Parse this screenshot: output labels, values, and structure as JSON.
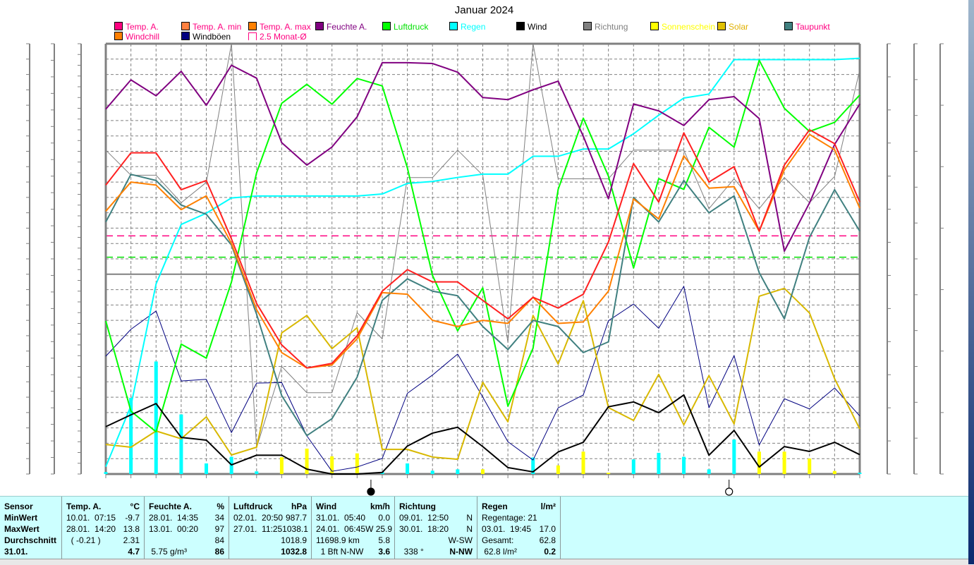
{
  "chart_data": {
    "type": "line",
    "title": "Januar 2024",
    "x": [
      1,
      2,
      3,
      4,
      5,
      6,
      7,
      8,
      9,
      10,
      11,
      12,
      13,
      14,
      15,
      16,
      17,
      18,
      19,
      20,
      21,
      22,
      23,
      24,
      25,
      26,
      27,
      28,
      29,
      30,
      31
    ],
    "xlim": [
      1,
      31
    ],
    "grid": true,
    "legend_position": "top",
    "axes": {
      "temp": {
        "unit": "°C",
        "min": -13,
        "max": 15,
        "color": "#ff0080",
        "side": "left",
        "ticks": [
          "15.0",
          "14.0",
          "13.0",
          "12.0",
          "11.0",
          "10.0",
          "9.0",
          "8.0",
          "7.0",
          "6.0",
          "5.0",
          "4.0",
          "3.0",
          "2.0",
          "1.0",
          "0.0",
          "-1.0",
          "-2.0",
          "-3.0",
          "-4.0",
          "-5.0",
          "-6.0",
          "-7.0",
          "-8.0",
          "-9.0",
          "-10.0",
          "-11.0",
          "-12.0",
          "-13.0"
        ]
      },
      "hpa": {
        "unit": "hPa",
        "min": 987,
        "max": 1039,
        "color": "#00e000",
        "side": "left",
        "ticks": [
          "1039",
          "1037",
          "1035",
          "1033",
          "1031",
          "1029",
          "1027",
          "1025",
          "1023",
          "1021",
          "1019",
          "1017",
          "1015",
          "1013",
          "1011",
          "1009",
          "1007",
          "1005",
          "1003",
          "1001",
          "999",
          "997",
          "995",
          "993",
          "991",
          "989",
          "987"
        ]
      },
      "kmh": {
        "unit": "km/h",
        "min": 0,
        "max": 80,
        "color": "#000000",
        "side": "left",
        "ticks": [
          "80.0",
          "78.0",
          "76.0",
          "74.0",
          "72.0",
          "70.0",
          "68.0",
          "66.0",
          "64.0",
          "62.0",
          "60.0",
          "58.0",
          "56.0",
          "54.0",
          "52.0",
          "50.0",
          "48.0",
          "46.0",
          "44.0",
          "42.0",
          "40.0",
          "38.0",
          "36.0",
          "34.0",
          "32.0",
          "30.0",
          "28.0",
          "26.0",
          "24.0",
          "22.0",
          "20.0",
          "18.0",
          "16.0",
          "14.0",
          "12.0",
          "10.0",
          "8.0",
          "6.0",
          "4.0",
          "2.0",
          "0.0"
        ]
      },
      "h": {
        "unit": "h",
        "min": 0,
        "max": 100,
        "color": "#e8e800",
        "side": "left",
        "ticks": [
          "100",
          "90",
          "80",
          "70",
          "60",
          "50",
          "40",
          "30",
          "20",
          "10",
          "0"
        ]
      },
      "pct": {
        "unit": "%",
        "min": 0,
        "max": 100,
        "color": "#800080",
        "side": "right",
        "ticks": [
          "100",
          "90",
          "80",
          "70",
          "60",
          "50",
          "40",
          "30",
          "20",
          "10",
          "0"
        ]
      },
      "lm2": {
        "unit": "l/m²",
        "min": 0,
        "max": 65,
        "color": "#00e8e8",
        "side": "right",
        "ticks": [
          "65.0",
          "60.0",
          "55.0",
          "50.0",
          "45.0",
          "40.0",
          "35.0",
          "30.0",
          "25.0",
          "20.0",
          "15.0",
          "10.0",
          "5.0",
          "0.0"
        ]
      },
      "deg": {
        "unit": "°",
        "min": 0,
        "max": 360,
        "color": "#808080",
        "side": "right",
        "ticks": [
          "360 N",
          "330",
          "300",
          "270 W",
          "240",
          "210",
          "180 S",
          "150",
          "120",
          "90 O",
          "60",
          "30",
          "0 N"
        ]
      },
      "wm2": {
        "unit": "W/m²",
        "min": 0,
        "max": 350,
        "color": "#d8b800",
        "side": "right",
        "ticks": [
          "350",
          "300",
          "250",
          "200",
          "150",
          "100",
          "50",
          "0"
        ]
      }
    },
    "series": [
      {
        "name": "Regen",
        "kind": "bar",
        "axis": "lm2",
        "color": "#00ffff",
        "values": [
          0.3,
          11.5,
          17.0,
          9.0,
          1.6,
          2.6,
          0.4,
          0,
          0,
          0,
          0,
          0.3,
          1.6,
          0.5,
          0.7,
          0.5,
          0,
          2.5,
          0,
          1.1,
          0,
          2.2,
          3.2,
          2.6,
          0.7,
          5.2,
          0,
          0,
          0,
          0,
          0.2
        ]
      },
      {
        "name": "Sonnenschein",
        "kind": "bar",
        "axis": "h",
        "color": "#ffff00",
        "values": [
          0,
          0,
          0,
          0,
          0,
          0,
          0,
          3.9,
          5.9,
          4.1,
          4.8,
          0,
          0,
          0,
          0,
          1.1,
          0,
          0,
          2.0,
          5.2,
          0.3,
          0,
          0,
          0,
          0,
          0,
          5.2,
          5.2,
          3.6,
          0.7,
          0
        ]
      },
      {
        "name": "Richtung",
        "kind": "line",
        "axis": "deg",
        "color": "#808080",
        "width": 1,
        "values": [
          271,
          250,
          250,
          227,
          244,
          360,
          22,
          90,
          68,
          68,
          135,
          113,
          248,
          248,
          271,
          250,
          110,
          360,
          247,
          247,
          247,
          271,
          271,
          271,
          222,
          247,
          222,
          248,
          227,
          249,
          338
        ]
      },
      {
        "name": "Windböen",
        "kind": "line",
        "axis": "kmh",
        "color": "#000080",
        "width": 1,
        "values": [
          21.9,
          26.9,
          30.3,
          17.3,
          17.6,
          7.7,
          16.9,
          17.0,
          7.1,
          0.5,
          1.3,
          2.9,
          15.0,
          18.4,
          22.3,
          14.3,
          6.0,
          2.6,
          12.3,
          14.7,
          28.5,
          31.6,
          27.1,
          34.9,
          12.3,
          22.0,
          5.4,
          14.0,
          12.1,
          16.0,
          10.8
        ]
      },
      {
        "name": "Solar",
        "kind": "line",
        "axis": "wm2",
        "color": "#d8b800",
        "width": 2,
        "values": [
          24,
          21.8,
          35,
          28.7,
          46.5,
          15.5,
          21.8,
          114.8,
          129,
          102,
          119,
          20,
          20,
          13.8,
          12,
          74.6,
          42.5,
          129,
          89.5,
          141,
          54,
          43.6,
          81,
          40,
          80,
          40.7,
          144.6,
          151,
          131,
          77.5,
          36.7
        ]
      },
      {
        "name": "Regen",
        "kind": "line",
        "axis": "lm2",
        "color": "#00ffff",
        "width": 2,
        "values": [
          1.1,
          10.3,
          28.7,
          37.7,
          39.4,
          41.7,
          42.0,
          42.0,
          42.0,
          42.0,
          42.0,
          42.3,
          43.9,
          44.2,
          44.8,
          45.3,
          45.3,
          48.0,
          48.0,
          49.1,
          49.1,
          51.4,
          54.2,
          56.8,
          57.4,
          62.6,
          62.6,
          62.6,
          62.6,
          62.6,
          62.8
        ]
      },
      {
        "name": "Luftdruck",
        "kind": "line",
        "axis": "hpa",
        "color": "#00ff00",
        "width": 2,
        "values": [
          1005.5,
          994.6,
          992.1,
          1002.7,
          1001.0,
          1010.2,
          1023.4,
          1031.8,
          1034.1,
          1031.7,
          1034.8,
          1033.9,
          1024.0,
          1011.0,
          1004.3,
          1009.5,
          995.2,
          1002.2,
          1021.4,
          1030.0,
          1023.0,
          1011.9,
          1022.7,
          1021.4,
          1028.9,
          1026.5,
          1037.0,
          1031.2,
          1028.4,
          1029.5,
          1032.8
        ]
      },
      {
        "name": "Feuchte A.",
        "kind": "line",
        "axis": "pct",
        "color": "#800080",
        "width": 2,
        "values": [
          84.8,
          91.6,
          87.9,
          93.6,
          85.7,
          95,
          92,
          77,
          71.8,
          76,
          83,
          95.6,
          95.6,
          95.4,
          93.4,
          87.5,
          87,
          89.3,
          91.3,
          78.5,
          64,
          86,
          84.4,
          81,
          87,
          87.7,
          82.6,
          51.8,
          63,
          76.6,
          86
        ]
      },
      {
        "name": "Taupunkt",
        "kind": "line",
        "axis": "temp",
        "color": "#408080",
        "width": 2,
        "values": [
          3.4,
          6.5,
          6.1,
          4.5,
          3.9,
          1.9,
          -2.6,
          -7.9,
          -10.5,
          -9.4,
          -6.7,
          -1.7,
          -0.3,
          -1.1,
          -1.4,
          -3.4,
          -4.9,
          -3.0,
          -3.4,
          -5.1,
          -4.4,
          5.0,
          3.4,
          6.1,
          4.0,
          5.1,
          0.1,
          -2.9,
          2.4,
          5.5,
          2.8
        ]
      },
      {
        "name": "Windchill",
        "kind": "line",
        "axis": "temp",
        "color": "#ff8000",
        "width": 2,
        "values": [
          4.1,
          6.0,
          5.8,
          4.2,
          5.1,
          2.0,
          -2.3,
          -5.1,
          -6.1,
          -5.9,
          -4.2,
          -1.2,
          -1.3,
          -3.0,
          -3.4,
          -3.0,
          -3.2,
          -1.5,
          -3.2,
          -3.1,
          -1.1,
          4.9,
          3.6,
          7.7,
          5.6,
          5.7,
          2.8,
          6.8,
          9.1,
          8.1,
          4.3
        ]
      },
      {
        "name": "Temp. A.",
        "kind": "line",
        "axis": "temp",
        "color": "#ff2020",
        "width": 2,
        "values": [
          5.8,
          7.9,
          7.9,
          5.5,
          6.1,
          2.3,
          -1.9,
          -4.6,
          -6.1,
          -5.8,
          -4.0,
          -1.1,
          0.3,
          -0.5,
          -0.5,
          -1.7,
          -2.9,
          -1.5,
          -2.2,
          -1.3,
          2.1,
          7.2,
          4.7,
          9.2,
          6.0,
          7.0,
          2.8,
          7.1,
          9.4,
          8.5,
          4.7
        ]
      },
      {
        "name": "Wind",
        "kind": "line",
        "axis": "kmh",
        "color": "#000000",
        "width": 2,
        "values": [
          8.8,
          11.0,
          13.1,
          6.8,
          6.3,
          1.7,
          3.5,
          3.5,
          0.9,
          0,
          0,
          0.3,
          5.2,
          7.6,
          8.7,
          5.1,
          1.2,
          0.4,
          4.1,
          5.9,
          12.5,
          13.4,
          11.4,
          14.7,
          3.5,
          8.1,
          1.3,
          5.1,
          4.2,
          5.9,
          3.6
        ]
      }
    ],
    "reference_lines": [
      {
        "name": "2.5 Monat-Ø",
        "axis": "temp",
        "value": 2.5,
        "color": "#ff0080",
        "style": "dashed"
      },
      {
        "axis": "hpa",
        "value": 1013.2,
        "color": "#00e000",
        "style": "dashed"
      },
      {
        "axis": "temp",
        "value": 0,
        "color": "#808080",
        "style": "solid"
      }
    ],
    "moon_phases": [
      {
        "phase": "new",
        "day": 11.55
      },
      {
        "phase": "full",
        "day": 25.8
      }
    ]
  },
  "legend": [
    {
      "label": "Temp. A.",
      "swatch": "#ff0080",
      "text_color": "#ff0080"
    },
    {
      "label": "Temp. A. min",
      "swatch": "#ff8040",
      "text_color": "#ff0080"
    },
    {
      "label": "Temp. A. max",
      "swatch": "#ff8000",
      "text_color": "#ff0080"
    },
    {
      "label": "Feuchte A.",
      "swatch": "#800080",
      "text_color": "#800080"
    },
    {
      "label": "Luftdruck",
      "swatch": "#00ff00",
      "text_color": "#00e000"
    },
    {
      "label": "Regen",
      "swatch": "#00ffff",
      "text_color": "#00ffff"
    },
    {
      "label": "Wind",
      "swatch": "#000000",
      "text_color": "#000000"
    },
    {
      "label": "Richtung",
      "swatch": "#808080",
      "text_color": "#808080"
    },
    {
      "label": "Sonnenschein",
      "swatch": "#ffff00",
      "text_color": "#ffff00"
    },
    {
      "label": "Solar",
      "swatch": "#e0c000",
      "text_color": "#e0b000"
    },
    {
      "label": "Taupunkt",
      "swatch": "#408080",
      "text_color": "#ff0080"
    },
    {
      "label": "Windchill",
      "swatch": "#ff8000",
      "text_color": "#ff0080"
    },
    {
      "label": "Windböen",
      "swatch": "#000080",
      "text_color": "#000000"
    },
    {
      "label": "2.5 Monat-Ø",
      "swatch": "hollow",
      "text_color": "#ff0080"
    }
  ],
  "table": {
    "columns": [
      {
        "header": [
          "Sensor",
          ""
        ],
        "rows": [
          [
            "MinWert",
            ""
          ],
          [
            "MaxWert",
            ""
          ],
          [
            "Durchschnitt",
            ""
          ],
          [
            "31.01.",
            ""
          ]
        ],
        "bold_labels": true
      },
      {
        "header": [
          "Temp. A.",
          "°C"
        ],
        "rows": [
          [
            "10.01.  07:15",
            "-9.7"
          ],
          [
            "28.01.  14:20",
            "13.8"
          ],
          [
            "  ( -0.21 )",
            "2.31"
          ],
          [
            "",
            "4.7"
          ]
        ]
      },
      {
        "header": [
          "Feuchte A.",
          "%"
        ],
        "rows": [
          [
            "28.01.  14:35",
            "34"
          ],
          [
            "13.01.  00:20",
            "97"
          ],
          [
            "",
            "84"
          ],
          [
            " 5.75 g/m³",
            "86"
          ]
        ]
      },
      {
        "header": [
          "Luftdruck",
          "hPa"
        ],
        "rows": [
          [
            "02.01.  20:50",
            "987.7"
          ],
          [
            "27.01.  11:25",
            "1038.1"
          ],
          [
            "",
            "1018.9"
          ],
          [
            "",
            "1032.8"
          ]
        ]
      },
      {
        "header": [
          "Wind",
          "km/h"
        ],
        "rows": [
          [
            "31.01.  05:40",
            "0.0"
          ],
          [
            "24.01.  06:45",
            "W 25.9"
          ],
          [
            "11698.9 km",
            "5.8"
          ],
          [
            "  1 Bft N-NW",
            "3.6"
          ]
        ]
      },
      {
        "header": [
          "Richtung",
          ""
        ],
        "rows": [
          [
            "09.01.  12:50",
            "N"
          ],
          [
            "30.01.  18:20",
            "N"
          ],
          [
            "",
            "W-SW"
          ],
          [
            "  338 °",
            "N-NW"
          ]
        ]
      },
      {
        "header": [
          "Regen",
          "l/m²"
        ],
        "rows": [
          [
            "Regentage: 21",
            ""
          ],
          [
            "03.01.  19:45",
            "17.0"
          ],
          [
            "Gesamt:",
            "62.8"
          ],
          [
            " 62.8 l/m²",
            "0.2"
          ]
        ]
      }
    ]
  }
}
